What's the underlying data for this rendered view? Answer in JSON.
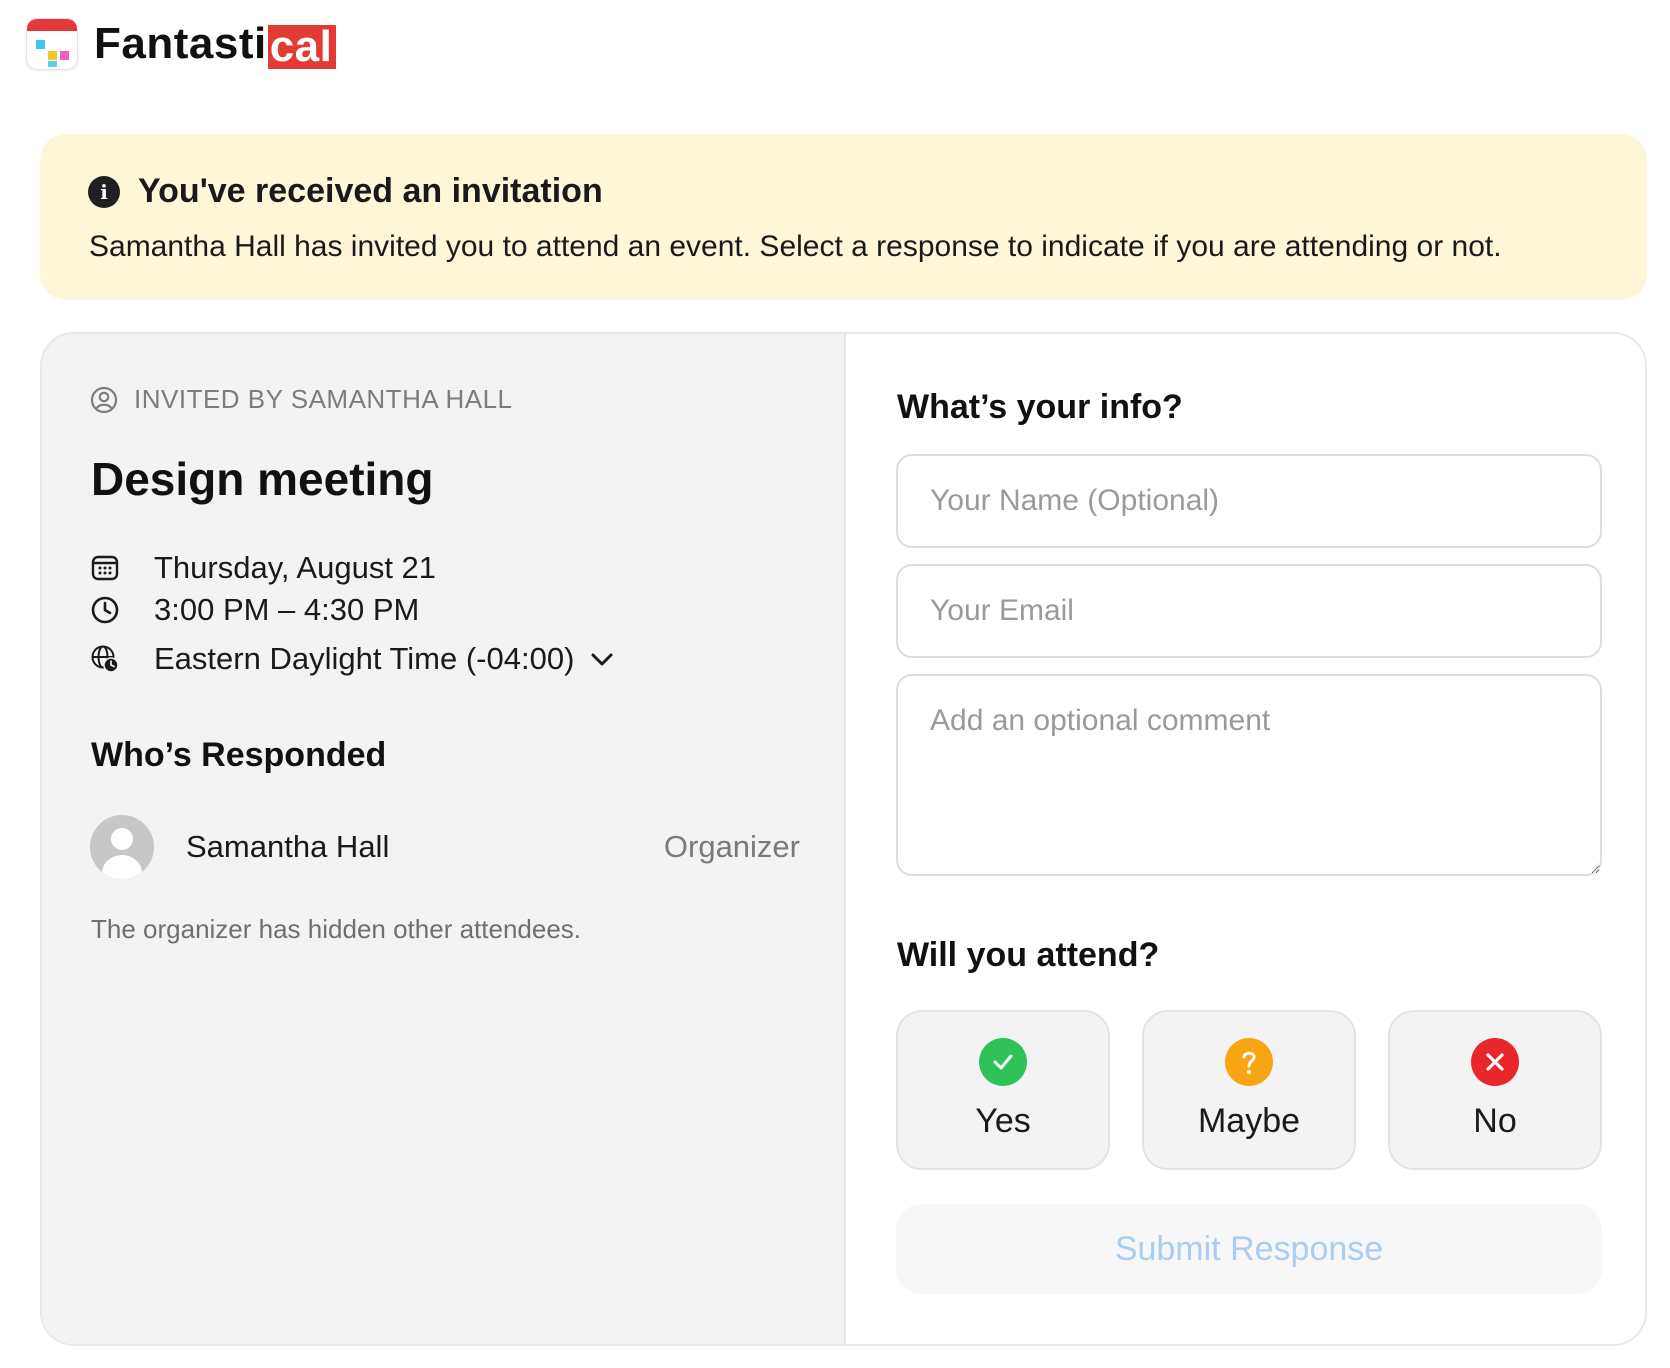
{
  "app": {
    "logo_text_main": "Fantasti",
    "logo_text_accent": "cal",
    "icon": "fantastical-app-icon"
  },
  "banner": {
    "icon": "info-icon",
    "title": "You've received an invitation",
    "message": "Samantha Hall has invited you to attend an event. Select a response to indicate if you are attending or not.",
    "background": "#fdf7d8"
  },
  "event": {
    "invited_by": "INVITED BY SAMANTHA HALL",
    "title": "Design meeting",
    "date": "Thursday, August 21",
    "time": "3:00 PM – 4:30 PM",
    "timezone": "Eastern Daylight Time (-04:00)"
  },
  "responses": {
    "title": "Who’s Responded",
    "attendees": [
      {
        "name": "Samantha Hall",
        "role": "Organizer"
      }
    ],
    "note": "The organizer has hidden other attendees."
  },
  "form": {
    "title": "What’s your info?",
    "name_placeholder": "Your Name (Optional)",
    "email_placeholder": "Your Email",
    "comment_placeholder": "Add an optional comment",
    "name_value": "",
    "email_value": "",
    "comment_value": ""
  },
  "attend": {
    "title": "Will you attend?",
    "options": [
      {
        "label": "Yes",
        "icon": "check-icon",
        "color": "#2fc256"
      },
      {
        "label": "Maybe",
        "icon": "question-icon",
        "color": "#f8a514"
      },
      {
        "label": "No",
        "icon": "x-icon",
        "color": "#e8262b"
      }
    ],
    "submit_label": "Submit Response",
    "submit_color": "#a9cdf3"
  }
}
